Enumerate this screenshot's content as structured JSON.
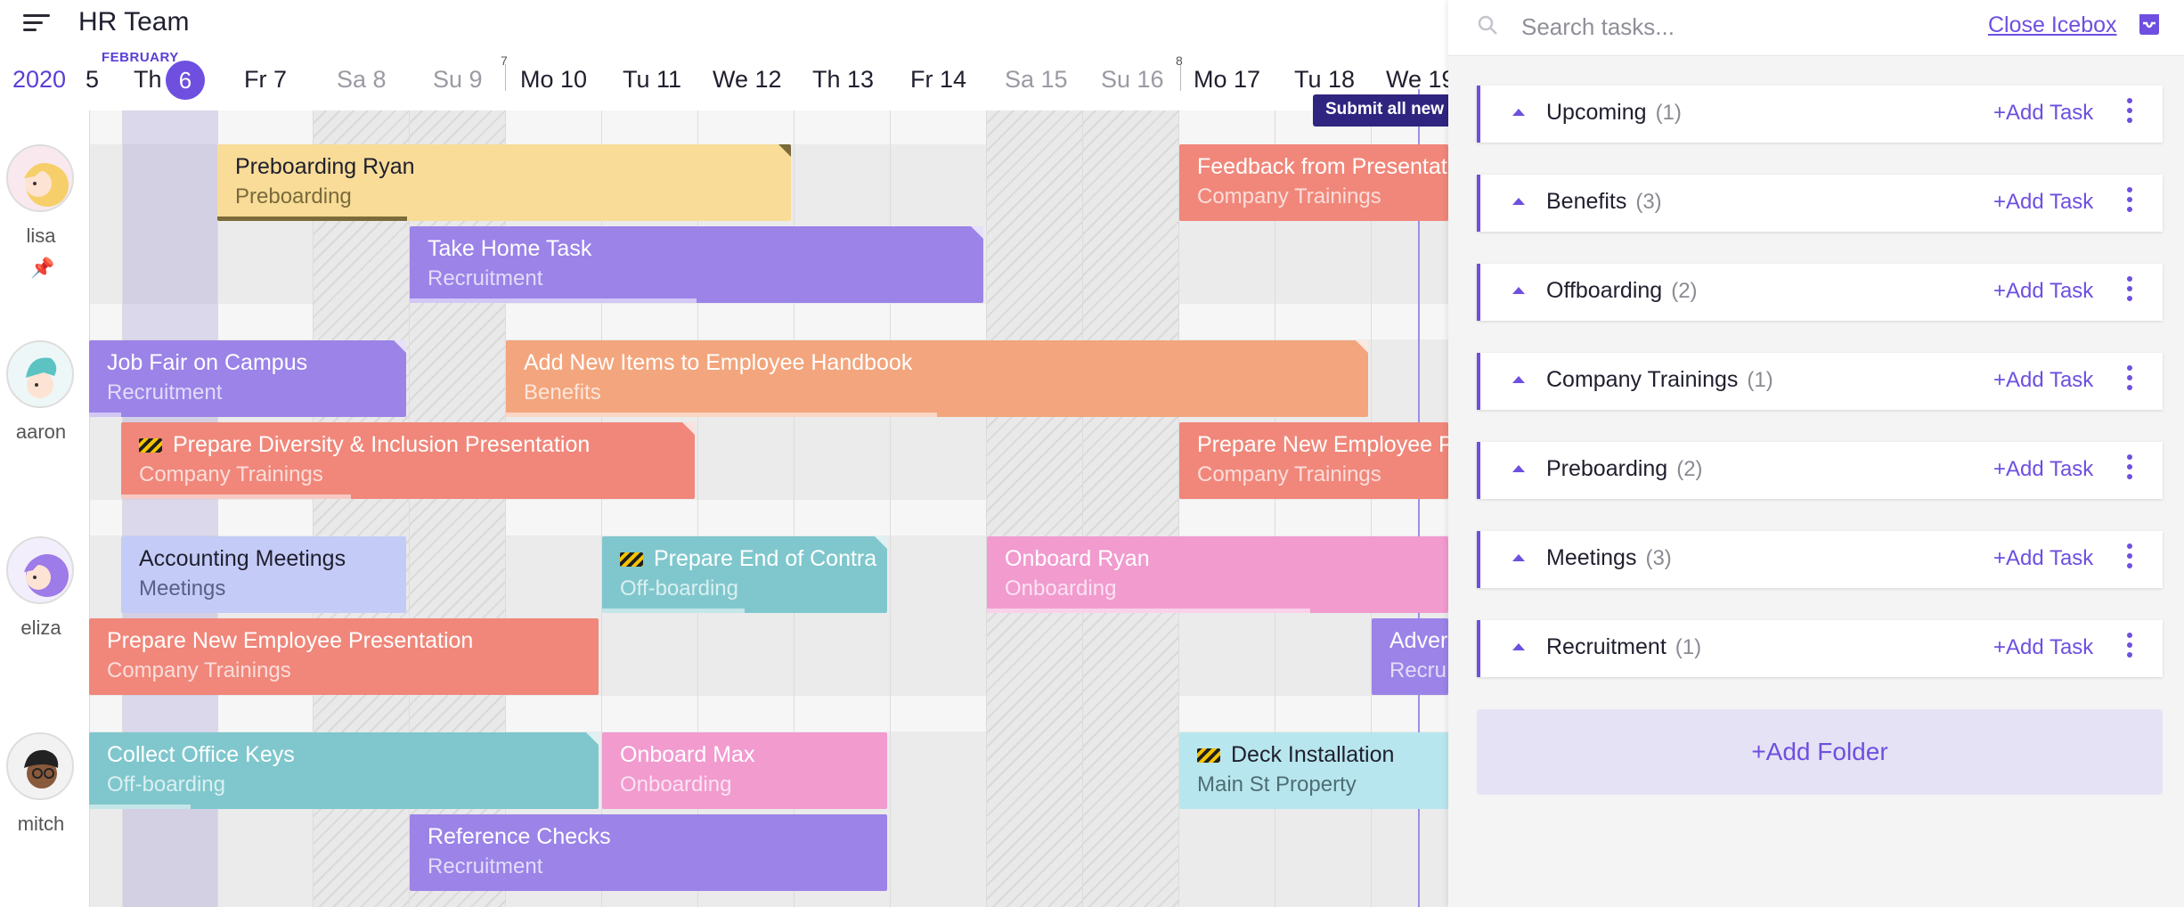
{
  "header": {
    "title": "HR Team",
    "year": "2020",
    "month": "FEBRUARY"
  },
  "timeline": {
    "days": [
      {
        "label": "5",
        "weekend": false
      },
      {
        "label": "Th",
        "weekend": false
      },
      {
        "label": "Fr 7",
        "weekend": false
      },
      {
        "label": "Sa 8",
        "weekend": true
      },
      {
        "label": "Su 9",
        "weekend": true
      },
      {
        "label": "Mo 10",
        "weekend": false
      },
      {
        "label": "Tu 11",
        "weekend": false
      },
      {
        "label": "We 12",
        "weekend": false
      },
      {
        "label": "Th 13",
        "weekend": false
      },
      {
        "label": "Fr 14",
        "weekend": false
      },
      {
        "label": "Sa 15",
        "weekend": true
      },
      {
        "label": "Su 16",
        "weekend": true
      },
      {
        "label": "Mo 17",
        "weekend": false
      },
      {
        "label": "Tu 18",
        "weekend": false
      },
      {
        "label": "We 19",
        "weekend": false
      }
    ],
    "today": "6",
    "week_numbers": [
      "7",
      "8"
    ],
    "submit_button": "Submit all new"
  },
  "users": [
    {
      "name": "lisa",
      "pinned": true
    },
    {
      "name": "aaron"
    },
    {
      "name": "eliza"
    },
    {
      "name": "mitch"
    }
  ],
  "tasks": [
    {
      "title": "Preboarding Ryan",
      "category": "Preboarding",
      "color": "yellow",
      "progress": 0.33
    },
    {
      "title": "Take Home Task",
      "category": "Recruitment",
      "color": "purple",
      "progress": 0.5
    },
    {
      "title": "Feedback from Presentat",
      "category": "Company Trainings",
      "color": "red",
      "progress": 0
    },
    {
      "title": "Job Fair on Campus",
      "category": "Recruitment",
      "color": "purple",
      "progress": 0.1
    },
    {
      "title": "Add New Items to Employee Handbook",
      "category": "Benefits",
      "color": "orange",
      "progress": 0.5
    },
    {
      "title": "Prepare Diversity & Inclusion Presentation",
      "category": "Company Trainings",
      "color": "red",
      "progress": 0.4,
      "warning": true
    },
    {
      "title": "Prepare New Employee P",
      "category": "Company Trainings",
      "color": "red",
      "progress": 0
    },
    {
      "title": "Accounting Meetings",
      "category": "Meetings",
      "color": "lavender",
      "progress": 0
    },
    {
      "title": "Prepare End of Contra",
      "category": "Off-boarding",
      "color": "teal",
      "progress": 0.5,
      "warning": true
    },
    {
      "title": "Onboard Ryan",
      "category": "Onboarding",
      "color": "pink",
      "progress": 0.7
    },
    {
      "title": "Prepare New Employee Presentation",
      "category": "Company Trainings",
      "color": "red",
      "progress": 0
    },
    {
      "title": "Adver",
      "category": "Recru",
      "color": "purple",
      "progress": 0
    },
    {
      "title": "Collect Office Keys",
      "category": "Off-boarding",
      "color": "teal",
      "progress": 0.2
    },
    {
      "title": "Onboard Max",
      "category": "Onboarding",
      "color": "pink",
      "progress": 0
    },
    {
      "title": "Deck Installation",
      "category": "Main St Property",
      "color": "lightcyan",
      "progress": 0,
      "warning": true
    },
    {
      "title": "Reference Checks",
      "category": "Recruitment",
      "color": "purple",
      "progress": 0
    }
  ],
  "icebox": {
    "search_placeholder": "Search tasks...",
    "close_label": "Close Icebox",
    "add_task_label": "+Add Task",
    "add_folder_label": "+Add Folder",
    "folders": [
      {
        "name": "Upcoming",
        "count": "(1)"
      },
      {
        "name": "Benefits",
        "count": "(3)"
      },
      {
        "name": "Offboarding",
        "count": "(2)"
      },
      {
        "name": "Company Trainings",
        "count": "(1)"
      },
      {
        "name": "Preboarding",
        "count": "(2)"
      },
      {
        "name": "Meetings",
        "count": "(3)"
      },
      {
        "name": "Recruitment",
        "count": "(1)"
      }
    ]
  },
  "colors": {
    "accent": "#6e4fe0",
    "submit": "#2f2580"
  }
}
